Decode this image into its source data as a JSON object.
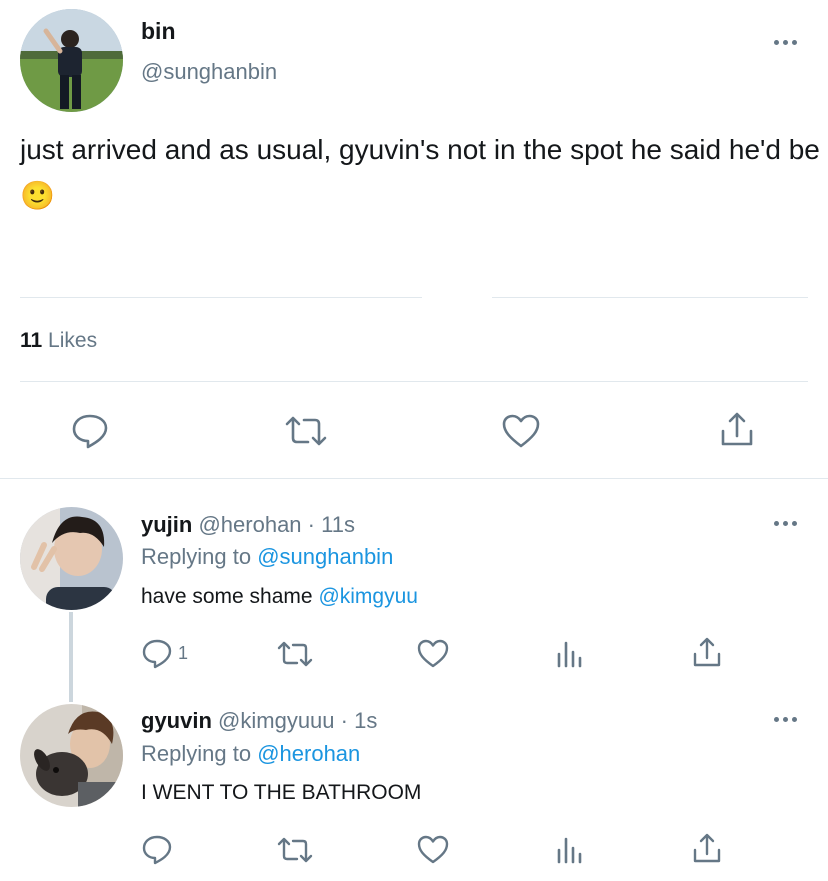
{
  "tweet": {
    "display_name": "bin",
    "handle": "@sunghanbin",
    "text": "just arrived and as usual, gyuvin's not in the spot he said he'd be 🙂",
    "likes_count": "11",
    "likes_label": "Likes",
    "avatar_icon": "profile-photo-person-in-field"
  },
  "replies": [
    {
      "display_name": "yujin",
      "handle": "@herohan",
      "time": "· 11s",
      "replying_prefix": "Replying to",
      "replying_to": "@sunghanbin",
      "text": "have some shame",
      "mention": "@kimgyuu",
      "reply_count": "1",
      "avatar_icon": "profile-photo-peace-sign"
    },
    {
      "display_name": "gyuvin",
      "handle": "@kimgyuuu",
      "time": "· 1s",
      "replying_prefix": "Replying to",
      "replying_to": "@herohan",
      "text": "I WENT TO THE BATHROOM",
      "mention": "",
      "reply_count": "",
      "avatar_icon": "profile-photo-with-dog"
    }
  ],
  "colors": {
    "link": "#1b95e0",
    "muted": "#657786",
    "divider": "#e1e8ed",
    "text": "#14171a"
  }
}
